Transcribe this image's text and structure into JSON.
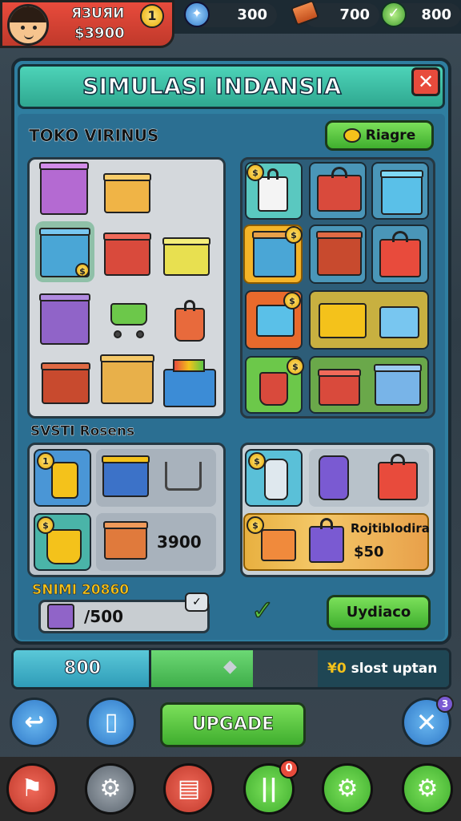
{
  "top": {
    "player_name": "ЯЗUЯИ",
    "player_gold": "$3900",
    "level_badge": "1",
    "stat_gems": "300",
    "stat_bricks": "700",
    "stat_energy": "800"
  },
  "dialog": {
    "title": "SIMULASI INDANSIA",
    "close_glyph": "✕"
  },
  "shop": {
    "section_title": "TOKO VIRINUS",
    "filter_button": "Riagre",
    "right_badges": [
      "$",
      "$",
      "$",
      "$"
    ]
  },
  "items": {
    "section_title": "SVSTI Rosens",
    "slot_badge": "1",
    "price_tag": "3900",
    "bundle_name": "Rojtiblodira",
    "bundle_price": "$50"
  },
  "balance": {
    "label": "SNIMI 20860",
    "value": "/500",
    "update_button": "Uydiaco"
  },
  "progress": {
    "left_value": "800",
    "right_text": "slost uptan",
    "right_prefix": "¥0",
    "fill_fraction": 0.55
  },
  "actions": {
    "back_glyph": "↩",
    "inventory_glyph": "▯",
    "upgrade_button": "UPGADE",
    "cancel_glyph": "✕",
    "cancel_badge": "3"
  },
  "dock": {
    "notif_badge": "0",
    "icons": [
      "flag-icon",
      "settings-icon",
      "shop-cart-icon",
      "stats-icon",
      "gear-icon",
      "gear-alt-icon"
    ]
  },
  "colors": {
    "panel_teal": "#2f7ea0",
    "title_green": "#3bbfa0",
    "button_green": "#5cc843",
    "close_red": "#e84b3c",
    "coin_yellow": "#f4c21b"
  }
}
